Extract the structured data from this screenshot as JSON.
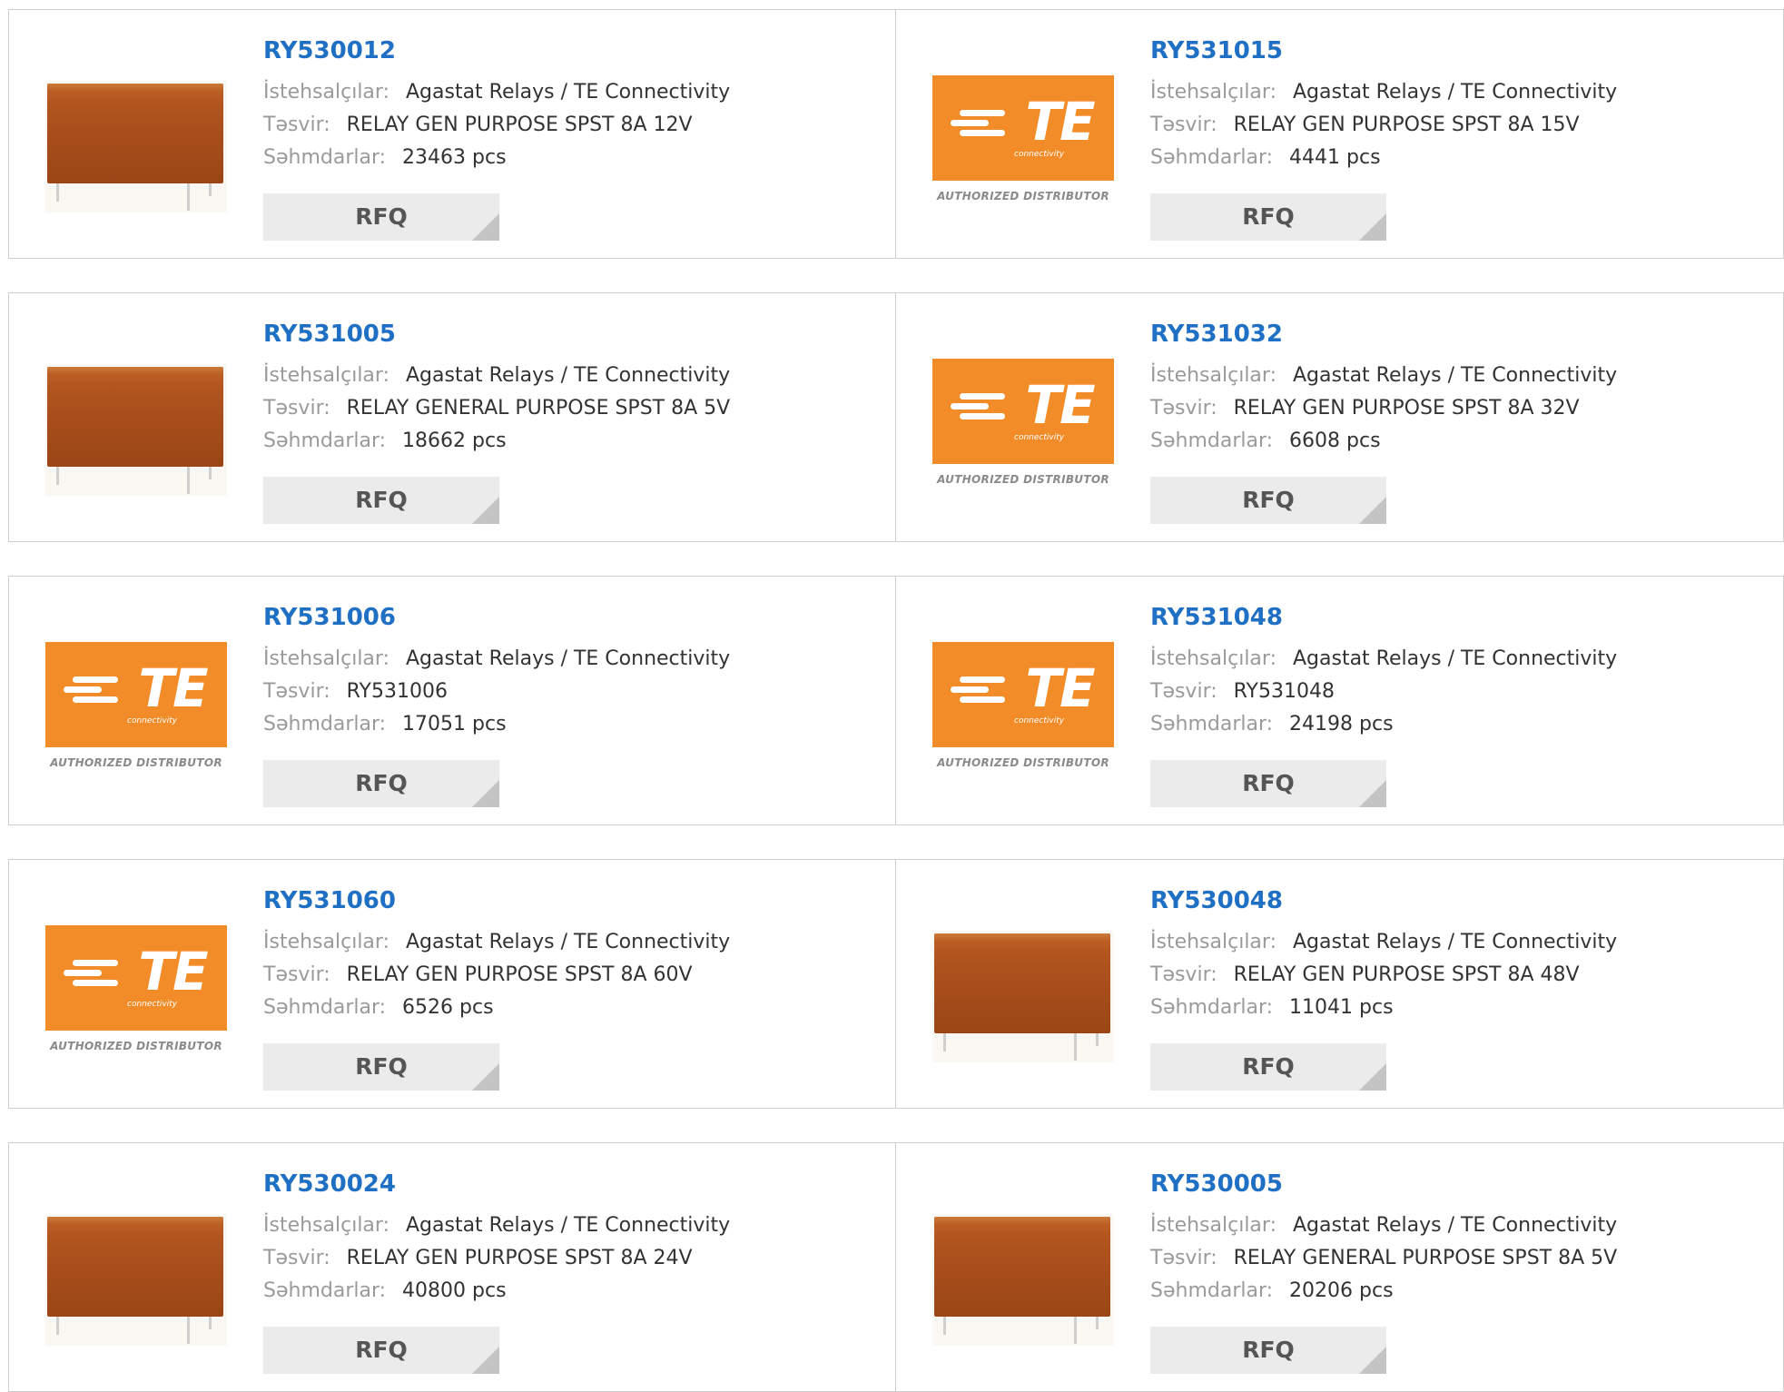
{
  "labels": {
    "manufacturer": "İstehsalçılar:",
    "description": "Təsvir:",
    "stock": "Səhmdarlar:",
    "rfq": "RFQ"
  },
  "brand": {
    "logo_text": "TE",
    "logo_sub": "connectivity",
    "authorized": "AUTHORIZED DISTRIBUTOR",
    "accent": "#f28c28",
    "link_color": "#1f6fc4"
  },
  "products": [
    {
      "part": "RY530012",
      "image": "relay",
      "manufacturer": "Agastat Relays / TE Connectivity",
      "description": "RELAY GEN PURPOSE SPST 8A 12V",
      "stock": "23463 pcs"
    },
    {
      "part": "RY531015",
      "image": "te-logo",
      "manufacturer": "Agastat Relays / TE Connectivity",
      "description": "RELAY GEN PURPOSE SPST 8A 15V",
      "stock": "4441 pcs"
    },
    {
      "part": "RY531005",
      "image": "relay",
      "manufacturer": "Agastat Relays / TE Connectivity",
      "description": "RELAY GENERAL PURPOSE SPST 8A 5V",
      "stock": "18662 pcs"
    },
    {
      "part": "RY531032",
      "image": "te-logo",
      "manufacturer": "Agastat Relays / TE Connectivity",
      "description": "RELAY GEN PURPOSE SPST 8A 32V",
      "stock": "6608 pcs"
    },
    {
      "part": "RY531006",
      "image": "te-logo",
      "manufacturer": "Agastat Relays / TE Connectivity",
      "description": "RY531006",
      "stock": "17051 pcs"
    },
    {
      "part": "RY531048",
      "image": "te-logo",
      "manufacturer": "Agastat Relays / TE Connectivity",
      "description": "RY531048",
      "stock": "24198 pcs"
    },
    {
      "part": "RY531060",
      "image": "te-logo",
      "manufacturer": "Agastat Relays / TE Connectivity",
      "description": "RELAY GEN PURPOSE SPST 8A 60V",
      "stock": "6526 pcs"
    },
    {
      "part": "RY530048",
      "image": "relay",
      "manufacturer": "Agastat Relays / TE Connectivity",
      "description": "RELAY GEN PURPOSE SPST 8A 48V",
      "stock": "11041 pcs"
    },
    {
      "part": "RY530024",
      "image": "relay",
      "manufacturer": "Agastat Relays / TE Connectivity",
      "description": "RELAY GEN PURPOSE SPST 8A 24V",
      "stock": "40800 pcs"
    },
    {
      "part": "RY530005",
      "image": "relay",
      "manufacturer": "Agastat Relays / TE Connectivity",
      "description": "RELAY GENERAL PURPOSE SPST 8A 5V",
      "stock": "20206 pcs"
    }
  ]
}
